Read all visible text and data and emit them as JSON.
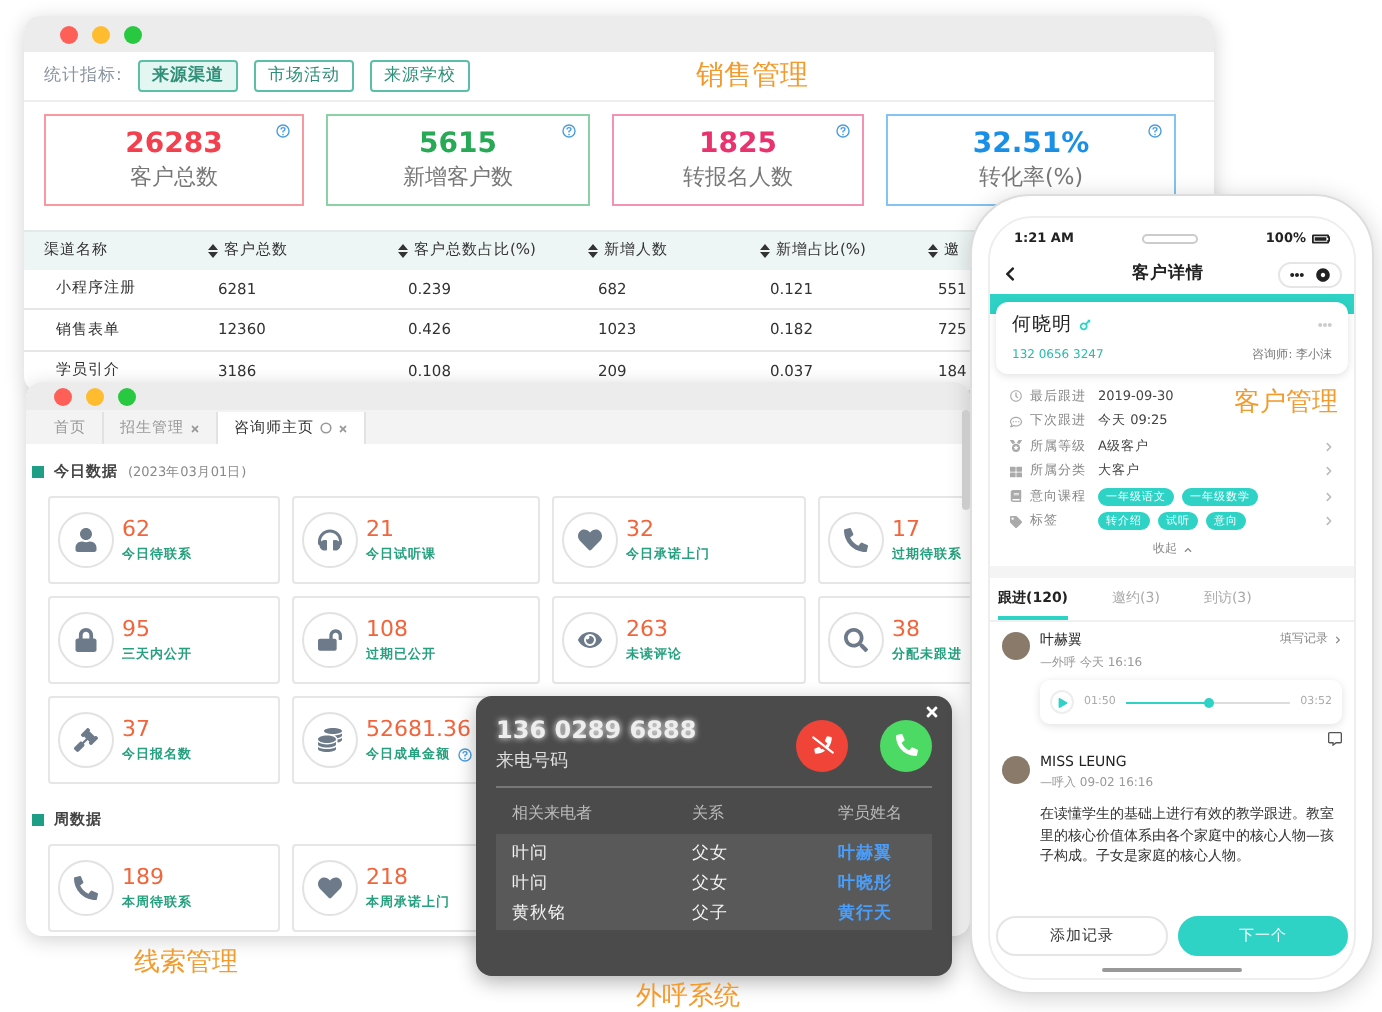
{
  "sales_window": {
    "title": "销售管理",
    "filter_label": "统计指标:",
    "filters": [
      {
        "label": "来源渠道",
        "selected": true
      },
      {
        "label": "市场活动",
        "selected": false
      },
      {
        "label": "来源学校",
        "selected": false
      }
    ],
    "stats": [
      {
        "value": "26283",
        "label": "客户总数",
        "color": "#f2404f"
      },
      {
        "value": "5615",
        "label": "新增客户数",
        "color": "#27a956"
      },
      {
        "value": "1825",
        "label": "转报名人数",
        "color": "#e8336e"
      },
      {
        "value": "32.51%",
        "label": "转化率(%)",
        "color": "#1a8fe6"
      }
    ],
    "table": {
      "columns": [
        {
          "label": "渠道名称",
          "sortable": false
        },
        {
          "label": "客户总数",
          "sortable": true
        },
        {
          "label": "客户总数占比(%)",
          "sortable": true
        },
        {
          "label": "新增人数",
          "sortable": true
        },
        {
          "label": "新增占比(%)",
          "sortable": true
        },
        {
          "label": "邀",
          "sortable": true
        }
      ],
      "rows": [
        [
          "小程序注册",
          "6281",
          "0.239",
          "682",
          "0.121",
          "551"
        ],
        [
          "销售表单",
          "12360",
          "0.426",
          "1023",
          "0.182",
          "725"
        ],
        [
          "学员引介",
          "3186",
          "0.108",
          "209",
          "0.037",
          "184"
        ]
      ]
    }
  },
  "leads_window": {
    "caption": "线索管理",
    "tabs": [
      {
        "label": "首页",
        "selected": false,
        "closable": false
      },
      {
        "label": "招生管理",
        "selected": false,
        "closable": true
      },
      {
        "label": "咨询师主页",
        "selected": true,
        "closable": true
      }
    ],
    "sections": [
      {
        "title": "今日数据",
        "date": "(2023年03月01日)",
        "cards": [
          {
            "value": "62",
            "label": "今日待联系",
            "kind": "user"
          },
          {
            "value": "21",
            "label": "今日试听课",
            "kind": "headphones"
          },
          {
            "value": "32",
            "label": "今日承诺上门",
            "kind": "heart"
          },
          {
            "value": "17",
            "label": "过期待联系",
            "kind": "phone"
          },
          {
            "value": "95",
            "label": "三天内公开",
            "kind": "lock"
          },
          {
            "value": "108",
            "label": "过期已公开",
            "kind": "unlock"
          },
          {
            "value": "263",
            "label": "未读评论",
            "kind": "eye"
          },
          {
            "value": "38",
            "label": "分配未跟进",
            "kind": "search"
          },
          {
            "value": "37",
            "label": "今日报名数",
            "kind": "gavel"
          },
          {
            "value": "52681.36",
            "label": "今日成单金额",
            "kind": "coins",
            "help": true
          }
        ]
      },
      {
        "title": "周数据",
        "cards": [
          {
            "value": "189",
            "label": "本周待联系",
            "kind": "phone"
          },
          {
            "value": "218",
            "label": "本周承诺上门",
            "kind": "heart"
          }
        ]
      }
    ]
  },
  "call_popup": {
    "caption": "外呼系统",
    "number": "136 0289 6888",
    "number_label": "来电号码",
    "columns": [
      "相关来电者",
      "关系",
      "学员姓名"
    ],
    "rows": [
      [
        "叶问",
        "父女",
        "叶赫翼"
      ],
      [
        "叶问",
        "父女",
        "叶晓彤"
      ],
      [
        "黄秋铭",
        "父子",
        "黄行天"
      ]
    ]
  },
  "phone": {
    "caption": "客户管理",
    "time": "1:21 AM",
    "battery": "100%",
    "title": "客户详情",
    "customer": {
      "name": "何晓明",
      "phone": "132 0656 3247",
      "advisor": "咨询师: 李小沫"
    },
    "fields": [
      {
        "label": "最后跟进",
        "kind": "info",
        "value": "2019-09-30"
      },
      {
        "label": "下次跟进",
        "kind": "info",
        "value": "今天 09:25"
      },
      {
        "label": "所属等级",
        "kind": "text",
        "value": "A级客户"
      },
      {
        "label": "所属分类",
        "kind": "text",
        "value": "大客户"
      },
      {
        "label": "意向课程",
        "kind": "tags",
        "tags": [
          "一年级语文",
          "一年级数学"
        ]
      },
      {
        "label": "标签",
        "kind": "tags",
        "tags": [
          "转介绍",
          "试听",
          "意向"
        ]
      }
    ],
    "collapse": "收起",
    "tabs": [
      {
        "label": "跟进(120)",
        "selected": true
      },
      {
        "label": "邀约(3)",
        "selected": false
      },
      {
        "label": "到访(3)",
        "selected": false
      }
    ],
    "records": [
      {
        "kind": "audio",
        "name": "叶赫翼",
        "meta": "—外呼  今天 16:16",
        "action": "填写记录",
        "start": "01:50",
        "end": "03:52",
        "level": 0.5
      },
      {
        "kind": "text",
        "name": "MISS LEUNG",
        "meta": "—呼入  09-02 16:16",
        "text": "在读懂学生的基础上进行有效的教学跟进。教室里的核心价值体系由各个家庭中的核心人物—孩子构成。子女是家庭的核心人物。"
      }
    ],
    "buttons": [
      "添加记录",
      "下一个"
    ]
  }
}
